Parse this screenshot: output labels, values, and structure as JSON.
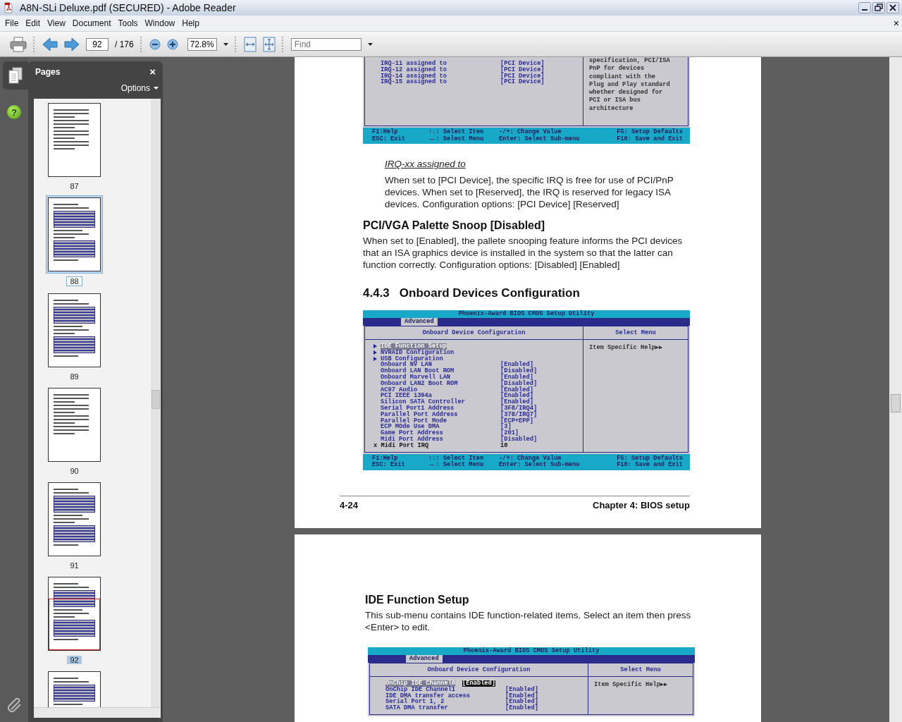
{
  "window": {
    "title": "A8N-SLi Deluxe.pdf (SECURED) - Adobe Reader"
  },
  "menu": [
    "File",
    "Edit",
    "View",
    "Document",
    "Tools",
    "Window",
    "Help"
  ],
  "document_close": "×",
  "toolbar": {
    "page_number": "92",
    "page_total": "/ 176",
    "zoom": "72.8%",
    "find_placeholder": "Find"
  },
  "sidebar": {
    "title": "Pages",
    "close": "×",
    "options": "Options",
    "help_label": "?",
    "thumbnails": [
      {
        "label": "87",
        "kind": "text",
        "selected": false,
        "in_view": false
      },
      {
        "label": "88",
        "kind": "bios",
        "selected": true,
        "in_view": false
      },
      {
        "label": "89",
        "kind": "bios",
        "selected": false,
        "in_view": false
      },
      {
        "label": "90",
        "kind": "text",
        "selected": false,
        "in_view": false
      },
      {
        "label": "91",
        "kind": "bios",
        "selected": false,
        "in_view": false
      },
      {
        "label": "92",
        "kind": "bios",
        "selected": false,
        "in_view": true
      },
      {
        "kind": "bios",
        "selected": false,
        "in_view": false
      }
    ]
  },
  "pages": [
    {
      "blocks": [
        {
          "kind": "bios",
          "rows": [
            {
              "kind": "item",
              "item": "IRQ-11 assigned to",
              "value": "[PCI Device]",
              "highlighted": false
            },
            {
              "kind": "item",
              "item": "IRQ-12 assigned to",
              "value": "[PCI Device]",
              "highlighted": false
            },
            {
              "kind": "item",
              "item": "IRQ-14 assigned to",
              "value": "[PCI Device]",
              "highlighted": false
            },
            {
              "kind": "item",
              "item": "IRQ-15 assigned to",
              "value": "[PCI Device]",
              "highlighted": false
            }
          ],
          "help_lines": [
            "specification, PCI/ISA",
            "PnP for devices",
            "compliant with the",
            "Plug and Play standard",
            "whether designed for",
            "PCI or ISA bus",
            "architecture"
          ],
          "keys": [
            "F1:Help",
            "↑↓: Select Item",
            "-/+: Change Value",
            "F5: Setup Defaults",
            "ESC: Exit",
            "→←: Select Menu",
            "Enter: Select Sub-menu",
            "F10: Save and Exit"
          ]
        },
        {
          "kind": "subheading",
          "text": "IRQ-xx assigned to"
        },
        {
          "kind": "sub_paragraph",
          "text": "When set to [PCI Device], the specific IRQ is free for use of PCI/PnP devices. When set to [Reserved], the IRQ is reserved for legacy ISA devices. Configuration options: [PCI Device] [Reserved]"
        },
        {
          "kind": "heading",
          "text": "PCI/VGA Palette Snoop [Disabled]"
        },
        {
          "kind": "paragraph",
          "text": "When set to [Enabled], the pallete snooping feature informs the PCI devices that an ISA graphics device is installed in the system so that the latter can function correctly. Configuration options: [Disabled] [Enabled]"
        },
        {
          "kind": "section_heading",
          "number": "4.4.3",
          "text": "Onboard Devices Configuration"
        },
        {
          "kind": "bios",
          "title": "Phoenix-Award BIOS CMOS Setup Utility",
          "tab": "Advanced",
          "left_header": "Onboard Device Configuration",
          "right_header": "Select Menu",
          "rows": [
            {
              "kind": "submenu",
              "item": "IDE Function Setup",
              "highlighted": true
            },
            {
              "kind": "submenu",
              "item": "NVRAID Configuration",
              "highlighted": false
            },
            {
              "kind": "submenu",
              "item": "USB Configuration",
              "highlighted": false
            },
            {
              "kind": "item",
              "item": "Onboard NV LAN",
              "value": "[Enabled]",
              "highlighted": false
            },
            {
              "kind": "item",
              "item": "Onboard LAN Boot ROM",
              "value": "[Disabled]",
              "highlighted": false
            },
            {
              "kind": "item",
              "item": "Onboard Marvell LAN",
              "value": "[Enabled]",
              "highlighted": false
            },
            {
              "kind": "item",
              "item": "Onboard LAN2 Boot ROM",
              "value": "[Disabled]",
              "highlighted": false
            },
            {
              "kind": "item",
              "item": "AC97 Audio",
              "value": "[Enabled]",
              "highlighted": false
            },
            {
              "kind": "item",
              "item": "PCI IEEE 1394a",
              "value": "[Enabled]",
              "highlighted": false
            },
            {
              "kind": "item",
              "item": "Silicon SATA Controller",
              "value": "[Enabled]",
              "highlighted": false
            },
            {
              "kind": "item",
              "item": "Serial Port1 Address",
              "value": "[3F8/IRQ4]",
              "highlighted": false
            },
            {
              "kind": "item",
              "item": "Parallel Port Address",
              "value": "[378/IRQ7]",
              "highlighted": false
            },
            {
              "kind": "item",
              "item": "Parallel Port Mode",
              "value": "[ECP+EPP]",
              "highlighted": false
            },
            {
              "kind": "item",
              "item": "ECP MOde Use DMA",
              "value": "[3]",
              "highlighted": false
            },
            {
              "kind": "item",
              "item": "Game Port Address",
              "value": "[201]",
              "highlighted": false
            },
            {
              "kind": "item",
              "item": "Midi Port Address",
              "value": "[Disabled]",
              "highlighted": false
            },
            {
              "kind": "locked",
              "item": "x Midi Port IRQ",
              "value": "10",
              "highlighted": false
            }
          ],
          "help_lines": [
            "Item Specific Help▶▶"
          ],
          "keys": [
            "F1:Help",
            "↑↓: Select Item",
            "-/+: Change Value",
            "F5: Setup Defaults",
            "ESC: Exit",
            "→←: Select Menu",
            "Enter: Select Sub-menu",
            "F10: Save and Exit"
          ]
        },
        {
          "kind": "page_footer",
          "left": "4-24",
          "right": "Chapter 4: BIOS setup"
        }
      ]
    },
    {
      "blocks": [
        {
          "kind": "heading",
          "text": "IDE Function Setup"
        },
        {
          "kind": "paragraph",
          "text": "This sub-menu contains IDE function-related items. Select an item then press <Enter> to edit."
        },
        {
          "kind": "bios",
          "title": "Phoenix-Award BIOS CMOS Setup Utility",
          "tab": "Advanced",
          "left_header": "Onboard Device Configuration",
          "right_header": "Select Menu",
          "rows": [
            {
              "kind": "item",
              "item": "OnChip IDE Channel0",
              "value": "[Enabled]",
              "highlighted": true
            },
            {
              "kind": "item",
              "item": "OnChip IDE Channel1",
              "value": "[Enabled]",
              "highlighted": false
            },
            {
              "kind": "item",
              "item": "IDE DMA transfer access",
              "value": "[Enabled]",
              "highlighted": false
            },
            {
              "kind": "item",
              "item": "Serial Port 1, 2",
              "value": "[Enabled]",
              "highlighted": false
            },
            {
              "kind": "item",
              "item": "SATA DMA transfer",
              "value": "[Enabled]",
              "highlighted": false
            }
          ],
          "help_lines": [
            "Item Specific Help▶▶"
          ]
        }
      ]
    }
  ]
}
